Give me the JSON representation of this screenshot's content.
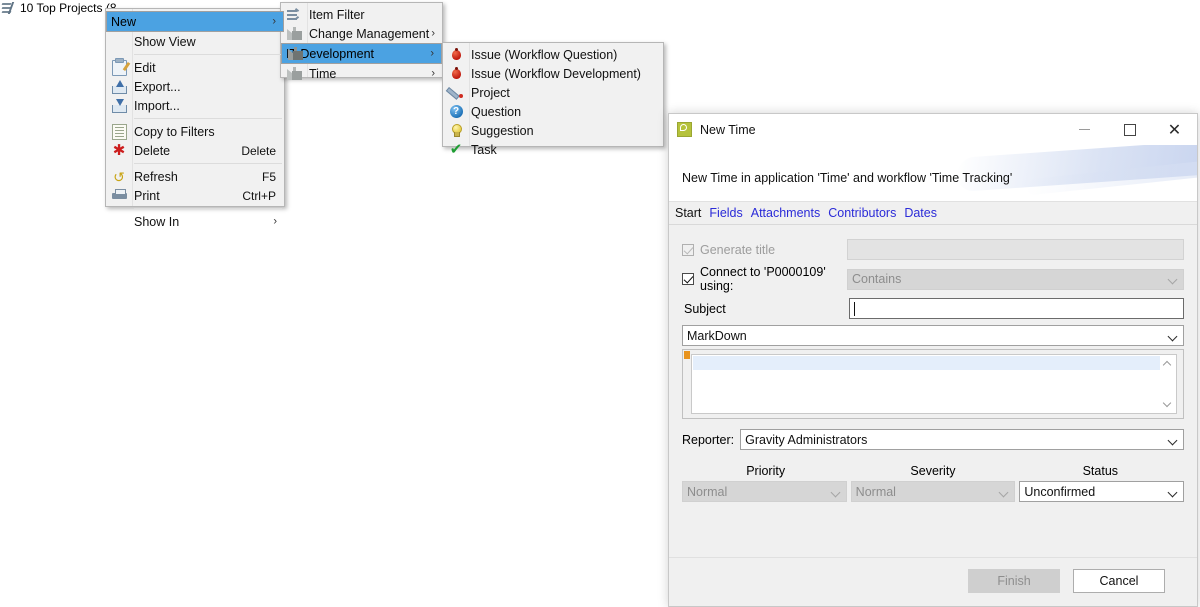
{
  "background": {
    "tab_label": "10 Top Projects (8",
    "tab_icon": "filter-flow-icon"
  },
  "context_menu": {
    "items": [
      {
        "label": "New",
        "icon": "",
        "accel": "",
        "submenu": true,
        "selected": true
      },
      {
        "label": "Show View",
        "icon": "",
        "accel": "",
        "submenu": false,
        "selected": false
      },
      {
        "separator": true
      },
      {
        "label": "Edit",
        "icon": "edit-icon",
        "accel": "",
        "submenu": false,
        "selected": false
      },
      {
        "label": "Export...",
        "icon": "export-icon",
        "accel": "",
        "submenu": false,
        "selected": false
      },
      {
        "label": "Import...",
        "icon": "import-icon",
        "accel": "",
        "submenu": false,
        "selected": false
      },
      {
        "separator": true
      },
      {
        "label": "Copy to Filters",
        "icon": "copy-icon",
        "accel": "",
        "submenu": false,
        "selected": false
      },
      {
        "label": "Delete",
        "icon": "delete-icon",
        "accel": "Delete",
        "submenu": false,
        "selected": false
      },
      {
        "separator": true
      },
      {
        "label": "Refresh",
        "icon": "refresh-icon",
        "accel": "F5",
        "submenu": false,
        "selected": false
      },
      {
        "label": "Print",
        "icon": "print-icon",
        "accel": "Ctrl+P",
        "submenu": false,
        "selected": false
      },
      {
        "separator": true
      },
      {
        "label": "Show In",
        "icon": "",
        "accel": "",
        "submenu": true,
        "selected": false
      }
    ]
  },
  "new_submenu": {
    "items": [
      {
        "label": "Item Filter",
        "icon": "item-filter-icon",
        "submenu": false,
        "selected": false
      },
      {
        "label": "Change Management",
        "icon": "factory-icon",
        "submenu": true,
        "selected": false
      },
      {
        "label": "IT Development",
        "icon": "factory-icon",
        "submenu": true,
        "selected": true
      },
      {
        "label": "Time",
        "icon": "factory-icon",
        "submenu": true,
        "selected": false
      }
    ]
  },
  "it_development_submenu": {
    "items": [
      {
        "label": "Issue (Workflow Question)",
        "icon": "bug-icon"
      },
      {
        "label": "Issue (Workflow Development)",
        "icon": "bug-icon"
      },
      {
        "label": "Project",
        "icon": "project-icon"
      },
      {
        "label": "Question",
        "icon": "question-icon"
      },
      {
        "label": "Suggestion",
        "icon": "lightbulb-icon"
      },
      {
        "label": "Task",
        "icon": "check-icon"
      }
    ]
  },
  "dialog": {
    "title": "New Time",
    "app_icon": "new-time-icon",
    "window_buttons": {
      "minimize": "–",
      "maximize": "□",
      "close": "✕"
    },
    "description": "New Time in application 'Time' and workflow 'Time Tracking'",
    "tabs": [
      {
        "label": "Start",
        "current": true
      },
      {
        "label": "Fields",
        "current": false
      },
      {
        "label": "Attachments",
        "current": false
      },
      {
        "label": "Contributors",
        "current": false
      },
      {
        "label": "Dates",
        "current": false
      }
    ],
    "form": {
      "generate_title": {
        "label": "Generate title",
        "checked": true,
        "enabled": false,
        "value": ""
      },
      "connect_to": {
        "label": "Connect to 'P0000109' using:",
        "checked": true,
        "enabled": true,
        "value": "Contains",
        "select_enabled": false
      },
      "subject": {
        "label": "Subject",
        "value": "",
        "focused": true
      },
      "format_select": {
        "value": "MarkDown"
      },
      "body_editor": {
        "value": ""
      },
      "reporter": {
        "label": "Reporter:",
        "value": "Gravity Administrators"
      },
      "triple": {
        "headers": [
          "Priority",
          "Severity",
          "Status"
        ],
        "values": [
          "Normal",
          "Normal",
          "Unconfirmed"
        ],
        "enabled": [
          false,
          false,
          true
        ]
      }
    },
    "buttons": {
      "finish": {
        "label": "Finish",
        "enabled": false
      },
      "cancel": {
        "label": "Cancel",
        "enabled": true
      }
    }
  },
  "colors": {
    "menu_highlight": "#4ba2e2",
    "link": "#2b2bd8",
    "accent_orange": "#e8941f",
    "app_icon": "#b5c23b"
  }
}
